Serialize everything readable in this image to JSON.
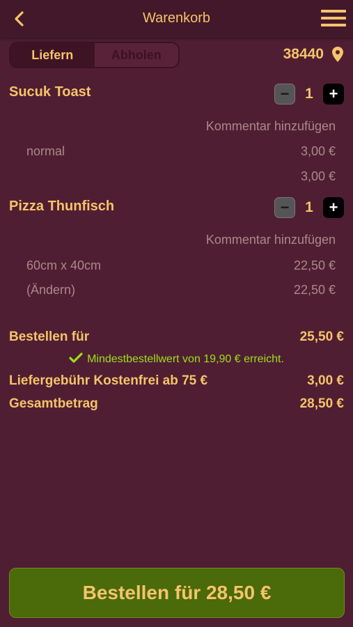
{
  "header": {
    "title": "Warenkorb"
  },
  "toggle": {
    "options": [
      "Liefern",
      "Abholen"
    ],
    "active": "Liefern"
  },
  "location": {
    "zip": "38440"
  },
  "items": [
    {
      "name": "Sucuk Toast",
      "quantity": "1",
      "comment_label": "Kommentar hinzufügen",
      "option_label": "normal",
      "option_price": "3,00 €",
      "subtotal": "3,00 €"
    },
    {
      "name": "Pizza Thunfisch",
      "quantity": "1",
      "comment_label": "Kommentar hinzufügen",
      "option_label": "60cm x 40cm",
      "option_price": "22,50 €",
      "change_label": "(Ändern)",
      "subtotal": "22,50 €"
    }
  ],
  "summary": {
    "order_for_label": "Bestellen für",
    "order_for_value": "25,50 €",
    "minimum_note": "Mindestbestellwert von 19,90 € erreicht.",
    "delivery_label": "Liefergebühr Kostenfrei ab 75 €",
    "delivery_value": "3,00 €",
    "total_label": "Gesamtbetrag",
    "total_value": "28,50 €"
  },
  "order_button": {
    "label": "Bestellen für 28,50 €"
  },
  "colors": {
    "background": "#501e32",
    "header": "#43182a",
    "accent_text": "#f5c46a",
    "muted_text": "#a98a8a",
    "success_text": "#9be01c",
    "order_button": "#4b6a0a"
  }
}
